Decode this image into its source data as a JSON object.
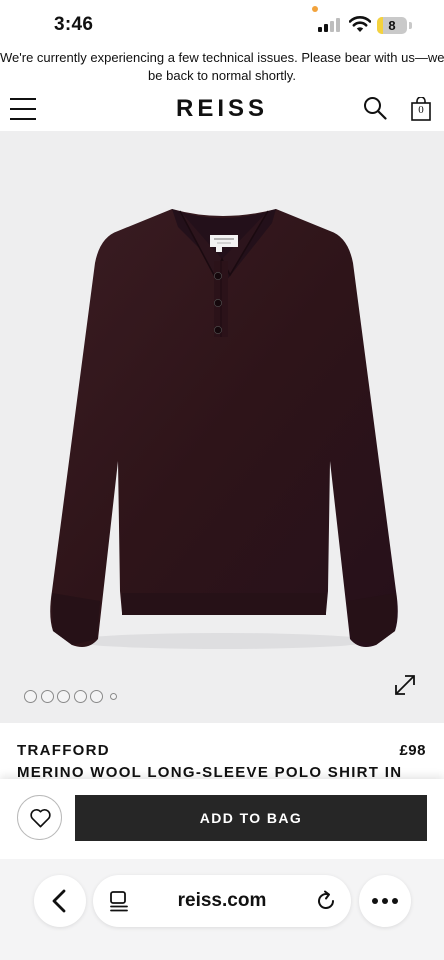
{
  "status_bar": {
    "time": "3:46",
    "battery": "8"
  },
  "notice": {
    "line1": "We're currently experiencing a few technical issues. Please bear with us—we'll",
    "line2": "be back to normal shortly."
  },
  "header": {
    "logo": "REISS",
    "bag_count": "0"
  },
  "product": {
    "brand": "TRAFFORD",
    "price": "£98",
    "name": "MERINO WOOL LONG-SLEEVE POLO SHIRT IN",
    "garment_color": "#2e1419",
    "background_color": "#eeeeef"
  },
  "gallery": {
    "image_count": 6,
    "current_index": 0
  },
  "actions": {
    "add_to_bag": "ADD TO BAG"
  },
  "browser": {
    "url": "reiss.com"
  },
  "icons": {
    "menu": "hamburger-icon",
    "search": "search-icon",
    "bag": "bag-icon",
    "expand": "expand-icon",
    "wishlist": "heart-icon",
    "back": "chevron-left-icon",
    "reader": "reader-icon",
    "reload": "reload-icon",
    "more": "ellipsis-icon"
  },
  "colors": {
    "button_bg": "#262626",
    "button_text": "#ffffff",
    "accent_dot": "#f2a33c"
  }
}
